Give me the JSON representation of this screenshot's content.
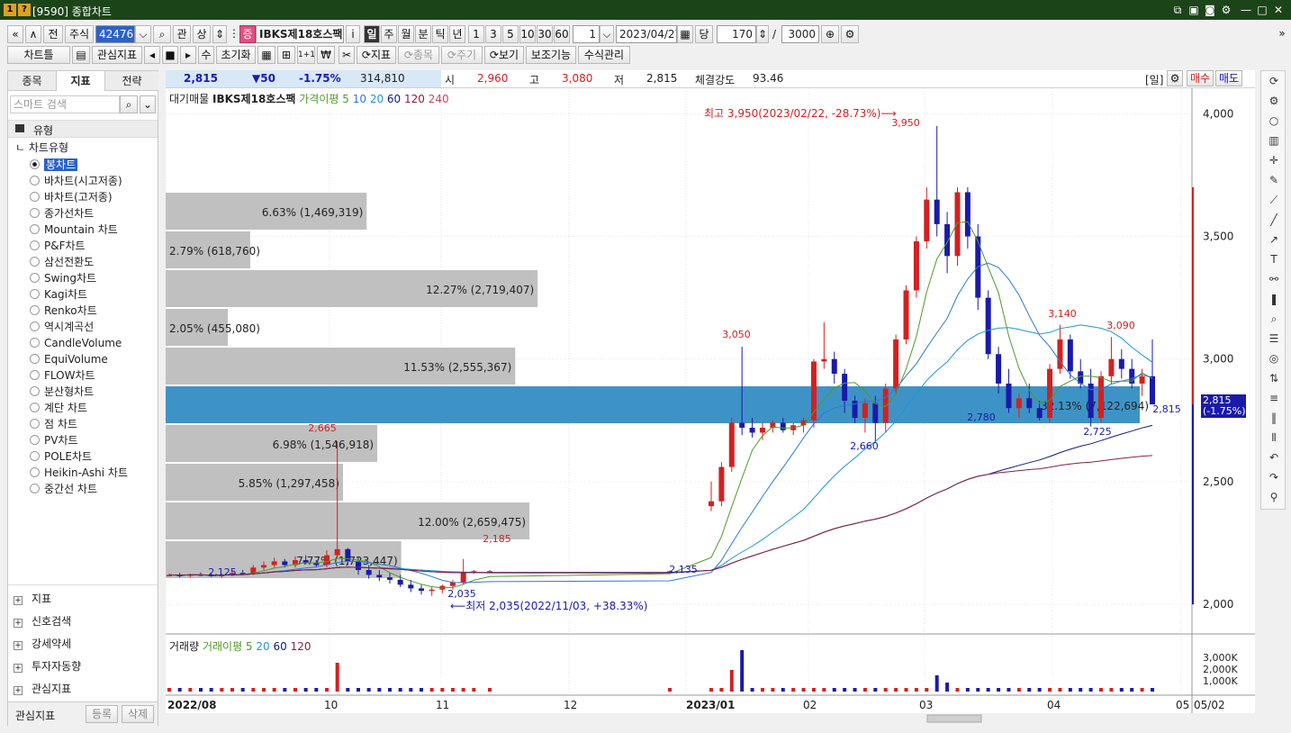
{
  "window": {
    "badge1": "1",
    "badge2": "?",
    "title": "[9590] 종합차트"
  },
  "toolbar1": {
    "nav_first": "«",
    "nav_up": "»",
    "prev_label": "전",
    "asset_type": "주식",
    "code_value": "424760",
    "search_icon": "search-icon",
    "rel_label": "관",
    "up_label": "상",
    "stock_badge": "증",
    "stock_name": "IBKS제18호스팩",
    "info_label": "i",
    "periods": [
      "일",
      "주",
      "월",
      "분",
      "틱",
      "년"
    ],
    "intervals": [
      "1",
      "3",
      "5",
      "10",
      "30",
      "60"
    ],
    "count_value": "1",
    "date_value": "2023/04/27",
    "dang_label": "당",
    "bars_value": "170",
    "slash": "/",
    "total_value": "3000"
  },
  "toolbar2": {
    "chart_label": "차트틀",
    "watch_label": "관심지표",
    "su_label": "수",
    "reset_label": "초기화",
    "plus1": "1+1",
    "indicator_label": "지표",
    "stock2_label": "종목",
    "period2_label": "주기",
    "view_label": "보기",
    "aux_label": "보조기능",
    "formula_label": "수식관리"
  },
  "sidebar": {
    "tabs": [
      "종목",
      "지표",
      "전략"
    ],
    "search_placeholder": "스마트 검색",
    "section": "유형",
    "group": "차트유형",
    "items": [
      "봉차트",
      "바차트(시고저종)",
      "바차트(고저종)",
      "종가선차트",
      "Mountain 차트",
      "P&F차트",
      "삼선전환도",
      "Swing차트",
      "Kagi차트",
      "Renko차트",
      "역시계곡선",
      "CandleVolume",
      "EquiVolume",
      "FLOW차트",
      "분산형차트",
      "계단 차트",
      "점 차트",
      "PV차트",
      "POLE차트",
      "Heikin-Ashi 차트",
      "중간선 차트"
    ],
    "groups": [
      "지표",
      "신호검색",
      "강세약세",
      "투자자동향",
      "관심지표"
    ],
    "footer_label": "관심지표",
    "register_label": "등록",
    "delete_label": "삭제"
  },
  "infobar": {
    "price": "2,815",
    "change": "▼50",
    "rate": "-1.75%",
    "volume": "314,810",
    "open_label": "시",
    "open": "2,960",
    "high_label": "고",
    "high": "3,080",
    "low_label": "저",
    "low": "2,815",
    "strength_label": "체결강도",
    "strength": "93.46",
    "period_tag": "[일]",
    "buy": "매수",
    "sell": "매도"
  },
  "legend": {
    "stock": "대기매물",
    "name": "IBKS제18호스팩",
    "ma_label": "가격이평 5",
    "ma": [
      "10",
      "20",
      "60",
      "120",
      "240"
    ]
  },
  "vol_legend": {
    "label": "거래량",
    "ma_label": "거래이평 5",
    "ma": [
      "20",
      "60",
      "120"
    ]
  },
  "chart_labels": {
    "max_note": "최고 3,950(2023/02/22, -28.73%)",
    "min_note": "최저 2,035(2022/11/03, +38.33%)",
    "current_tag": "2,815",
    "current_rate": "(-1.75%)"
  },
  "colors": {
    "up": "#d42020",
    "down": "#1a1aaa",
    "ma5": "#4f9a2a",
    "ma10": "#2e77d8",
    "ma20": "#1c96d8",
    "ma60": "#101a7a",
    "ma120": "#8a2040",
    "highlight": "#3e93c6",
    "bar": "#c0c0c0"
  },
  "chart_data": {
    "type": "candlestick",
    "x_ticks": [
      "2022/08",
      "10",
      "11",
      "12",
      "2023/01",
      "02",
      "03",
      "04",
      "05",
      "05/02"
    ],
    "y_ticks": [
      "4,000",
      "3,500",
      "3,000",
      "2,500",
      "2,000"
    ],
    "ylim": [
      1960,
      4060
    ],
    "vol_ticks": [
      "3,000K",
      "2,000K",
      "1,000K"
    ],
    "price_labels": [
      "3,950",
      "3,050",
      "3,140",
      "3,090",
      "2,665",
      "2,185",
      "2,125",
      "2,035",
      "2,135",
      "2,660",
      "2,780",
      "2,725",
      "2,815"
    ],
    "volume_profile": [
      {
        "label": "6.63% (1,469,319)",
        "pct": 6.63
      },
      {
        "label": "2.79% (618,760)",
        "pct": 2.79
      },
      {
        "label": "12.27% (2,719,407)",
        "pct": 12.27
      },
      {
        "label": "2.05% (455,080)",
        "pct": 2.05
      },
      {
        "label": "11.53% (2,555,367)",
        "pct": 11.53
      },
      {
        "label": "32.13% (7,122,694)",
        "pct": 32.13
      },
      {
        "label": "6.98% (1,546,918)",
        "pct": 6.98
      },
      {
        "label": "5.85% (1,297,458)",
        "pct": 5.85
      },
      {
        "label": "12.00% (2,659,475)",
        "pct": 12.0
      },
      {
        "label": "7.77% (1,723,447)",
        "pct": 7.77
      }
    ],
    "candles": [
      [
        2120,
        2125,
        2115,
        2120
      ],
      [
        2120,
        2128,
        2110,
        2118
      ],
      [
        2118,
        2125,
        2110,
        2122
      ],
      [
        2122,
        2130,
        2115,
        2120
      ],
      [
        2120,
        2128,
        2112,
        2115
      ],
      [
        2115,
        2125,
        2108,
        2120
      ],
      [
        2120,
        2135,
        2115,
        2128
      ],
      [
        2128,
        2140,
        2120,
        2125
      ],
      [
        2125,
        2160,
        2120,
        2150
      ],
      [
        2150,
        2175,
        2140,
        2160
      ],
      [
        2160,
        2190,
        2150,
        2175
      ],
      [
        2175,
        2185,
        2150,
        2160
      ],
      [
        2160,
        2195,
        2150,
        2180
      ],
      [
        2180,
        2200,
        2165,
        2170
      ],
      [
        2170,
        2180,
        2150,
        2160
      ],
      [
        2160,
        2220,
        2150,
        2200
      ],
      [
        2200,
        2665,
        2190,
        2225
      ],
      [
        2225,
        2230,
        2160,
        2175
      ],
      [
        2175,
        2190,
        2120,
        2140
      ],
      [
        2140,
        2160,
        2105,
        2120
      ],
      [
        2120,
        2140,
        2095,
        2110
      ],
      [
        2110,
        2130,
        2085,
        2100
      ],
      [
        2100,
        2120,
        2070,
        2080
      ],
      [
        2080,
        2100,
        2050,
        2065
      ],
      [
        2065,
        2080,
        2040,
        2055
      ],
      [
        2055,
        2070,
        2035,
        2060
      ],
      [
        2060,
        2080,
        2045,
        2075
      ],
      [
        2075,
        2100,
        2060,
        2090
      ],
      [
        2090,
        2185,
        2080,
        2130
      ],
      [
        2130,
        2140,
        2125,
        2135
      ],
      [
        2135,
        2140,
        2130,
        2135
      ],
      [
        2135,
        2138,
        2130,
        2135
      ],
      [
        2400,
        2500,
        2380,
        2420
      ],
      [
        2420,
        2580,
        2400,
        2560
      ],
      [
        2560,
        2760,
        2540,
        2740
      ],
      [
        2740,
        3050,
        2690,
        2720
      ],
      [
        2720,
        2760,
        2680,
        2700
      ],
      [
        2700,
        2740,
        2670,
        2720
      ],
      [
        2720,
        2750,
        2700,
        2740
      ],
      [
        2740,
        2760,
        2700,
        2710
      ],
      [
        2710,
        2740,
        2690,
        2730
      ],
      [
        2730,
        2760,
        2700,
        2750
      ],
      [
        2750,
        3000,
        2720,
        2990
      ],
      [
        2990,
        3150,
        2960,
        3000
      ],
      [
        3000,
        3030,
        2900,
        2940
      ],
      [
        2940,
        2960,
        2780,
        2830
      ],
      [
        2830,
        2850,
        2740,
        2760
      ],
      [
        2760,
        2840,
        2700,
        2820
      ],
      [
        2820,
        2850,
        2660,
        2740
      ],
      [
        2740,
        2900,
        2700,
        2880
      ],
      [
        2880,
        3100,
        2860,
        3080
      ],
      [
        3080,
        3300,
        3060,
        3280
      ],
      [
        3280,
        3500,
        3250,
        3480
      ],
      [
        3480,
        3700,
        3450,
        3650
      ],
      [
        3650,
        3950,
        3500,
        3550
      ],
      [
        3550,
        3600,
        3350,
        3420
      ],
      [
        3420,
        3700,
        3380,
        3680
      ],
      [
        3680,
        3700,
        3450,
        3500
      ],
      [
        3500,
        3550,
        3200,
        3250
      ],
      [
        3250,
        3280,
        3000,
        3020
      ],
      [
        3020,
        3050,
        2860,
        2900
      ],
      [
        2900,
        2960,
        2780,
        2800
      ],
      [
        2800,
        2860,
        2760,
        2840
      ],
      [
        2840,
        2900,
        2780,
        2800
      ],
      [
        2800,
        2830,
        2750,
        2760
      ],
      [
        2760,
        2980,
        2740,
        2960
      ],
      [
        2960,
        3140,
        2940,
        3080
      ],
      [
        3080,
        3100,
        2920,
        2950
      ],
      [
        2950,
        3000,
        2880,
        2900
      ],
      [
        2900,
        2960,
        2725,
        2760
      ],
      [
        2760,
        2950,
        2740,
        2930
      ],
      [
        2930,
        3090,
        2900,
        3000
      ],
      [
        3000,
        3040,
        2920,
        2960
      ],
      [
        2960,
        3000,
        2880,
        2900
      ],
      [
        2900,
        2960,
        2850,
        2930
      ],
      [
        2930,
        3080,
        2815,
        2815
      ]
    ]
  }
}
